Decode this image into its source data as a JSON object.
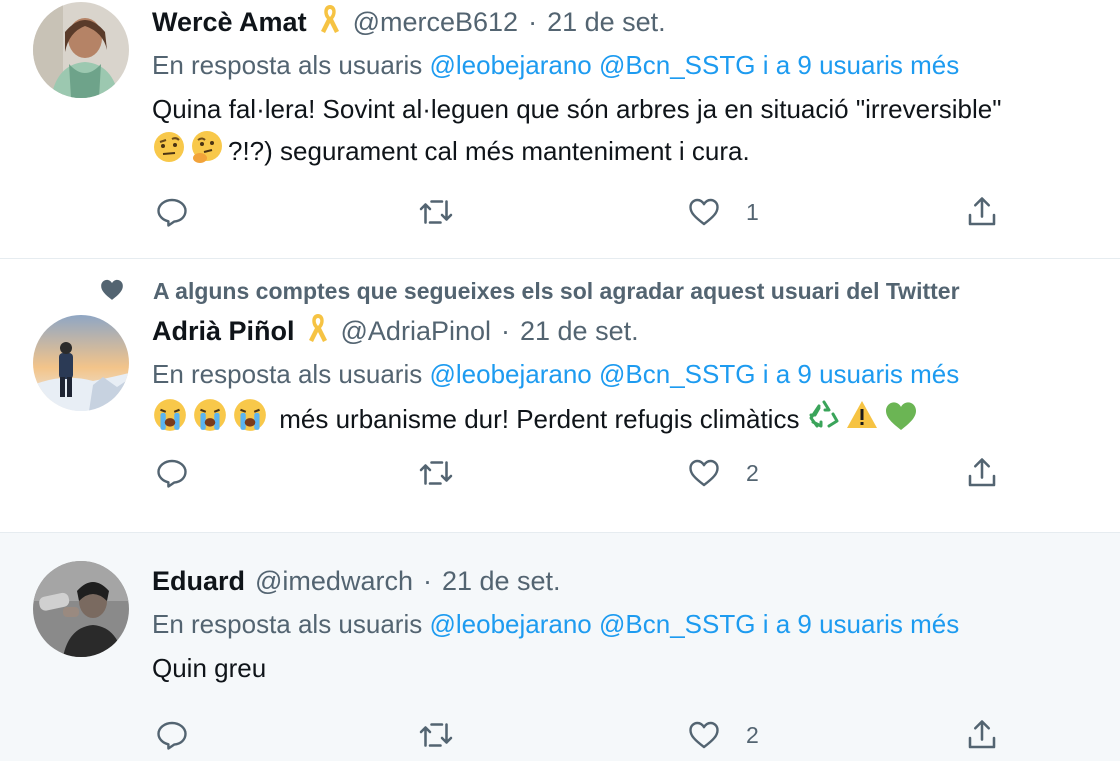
{
  "tweets": [
    {
      "name": "Wercè Amat",
      "handle": "@merceB612",
      "dot": "·",
      "date": "21 de set.",
      "reply_prefix": "En resposta als usuaris",
      "mentions": [
        "@leobejarano",
        "@Bcn_SSTG"
      ],
      "reply_others": "i a 9 usuaris més",
      "text_line1": "Quina fal·lera! Sovint al·leguen que són arbres ja en situació \"irreversible\"",
      "text_line2": "?!?) segurament cal més manteniment i cura.",
      "like_count": "1",
      "avatar_colors": [
        "#d9d4cc",
        "#7a5a45",
        "#9cc8b0"
      ]
    },
    {
      "social_context": "A alguns comptes que segueixes els sol agradar aquest usuari del Twitter",
      "name": "Adrià Piñol",
      "handle": "@AdriaPinol",
      "dot": "·",
      "date": "21 de set.",
      "reply_prefix": "En resposta als usuaris",
      "mentions": [
        "@leobejarano",
        "@Bcn_SSTG"
      ],
      "reply_others": "i a 9 usuaris més",
      "text": "més urbanisme dur! Perdent refugis climàtics",
      "like_count": "2",
      "avatar_colors": [
        "#f3c48a",
        "#3b4d6b",
        "#e8eef5"
      ]
    },
    {
      "name": "Eduard",
      "handle": "@imedwarch",
      "dot": "·",
      "date": "21 de set.",
      "reply_prefix": "En resposta als usuaris",
      "mentions": [
        "@leobejarano",
        "@Bcn_SSTG"
      ],
      "reply_others": "i a 9 usuaris més",
      "text": "Quin greu",
      "like_count": "2",
      "avatar_colors": [
        "#8a8a8a",
        "#2a2a2a",
        "#d0d0d0"
      ]
    }
  ],
  "icons": {
    "reply": "reply-icon",
    "retweet": "retweet-icon",
    "like": "heart-icon",
    "share": "share-icon",
    "ribbon": "yellow-ribbon-icon",
    "social_heart": "heart-filled-icon"
  },
  "colors": {
    "link": "#1d9bf0",
    "muted": "#536471",
    "text": "#0f1419",
    "ribbon": "#f6c343",
    "highlight_bg": "#f5f8fa"
  }
}
